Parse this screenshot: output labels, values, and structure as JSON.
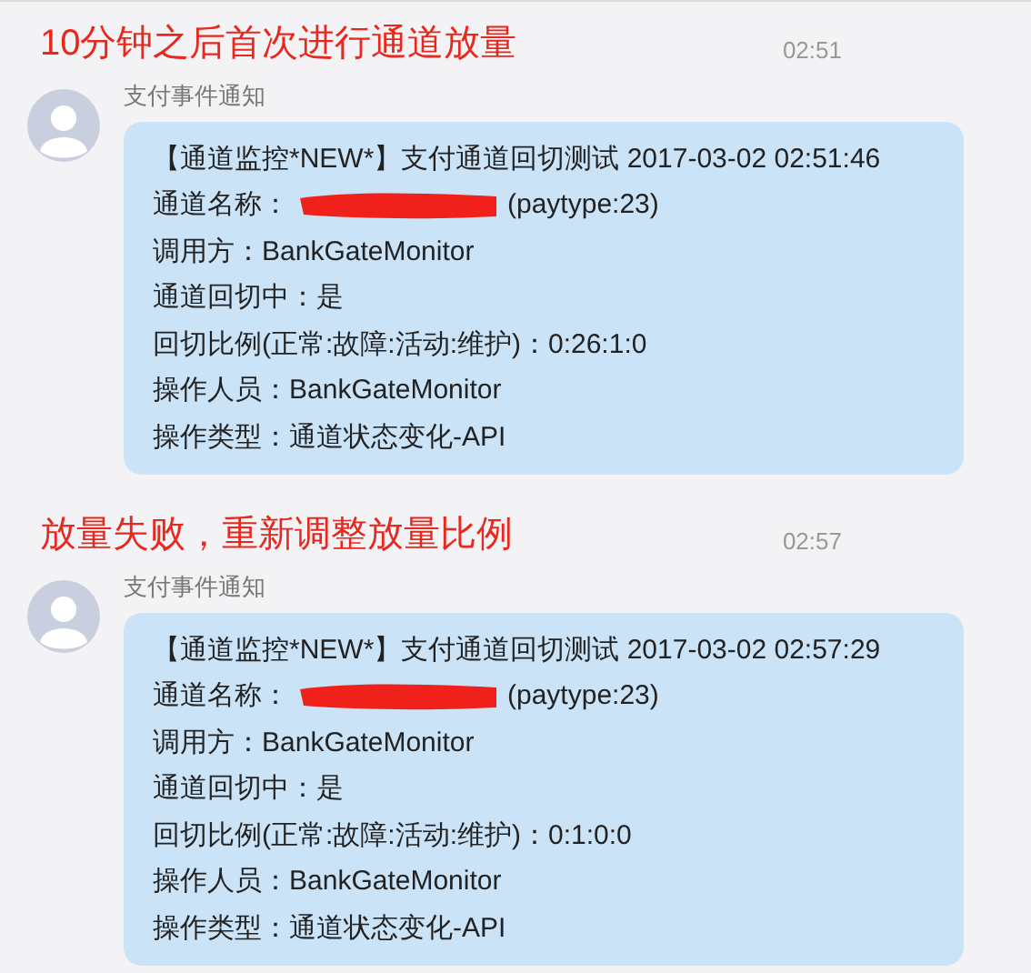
{
  "messages": [
    {
      "annotation": "10分钟之后首次进行通道放量",
      "time": "02:51",
      "sender": "支付事件通知",
      "lines": [
        {
          "kind": "text",
          "text": "【通道监控*NEW*】支付通道回切测试 2017-03-02 02:51:46"
        },
        {
          "kind": "redacted",
          "label": "通道名称：",
          "suffix": "(paytype:23)"
        },
        {
          "kind": "text",
          "text": "调用方：BankGateMonitor"
        },
        {
          "kind": "text",
          "text": "通道回切中：是"
        },
        {
          "kind": "text",
          "text": "回切比例(正常:故障:活动:维护)：0:26:1:0"
        },
        {
          "kind": "text",
          "text": "操作人员：BankGateMonitor"
        },
        {
          "kind": "text",
          "text": "操作类型：通道状态变化-API"
        }
      ]
    },
    {
      "annotation": "放量失败，重新调整放量比例",
      "time": "02:57",
      "sender": "支付事件通知",
      "lines": [
        {
          "kind": "text",
          "text": "【通道监控*NEW*】支付通道回切测试 2017-03-02 02:57:29"
        },
        {
          "kind": "redacted",
          "label": "通道名称：",
          "suffix": "(paytype:23)"
        },
        {
          "kind": "text",
          "text": "调用方：BankGateMonitor"
        },
        {
          "kind": "text",
          "text": "通道回切中：是"
        },
        {
          "kind": "text",
          "text": "回切比例(正常:故障:活动:维护)：0:1:0:0"
        },
        {
          "kind": "text",
          "text": "操作人员：BankGateMonitor"
        },
        {
          "kind": "text",
          "text": "操作类型：通道状态变化-API"
        }
      ]
    }
  ]
}
